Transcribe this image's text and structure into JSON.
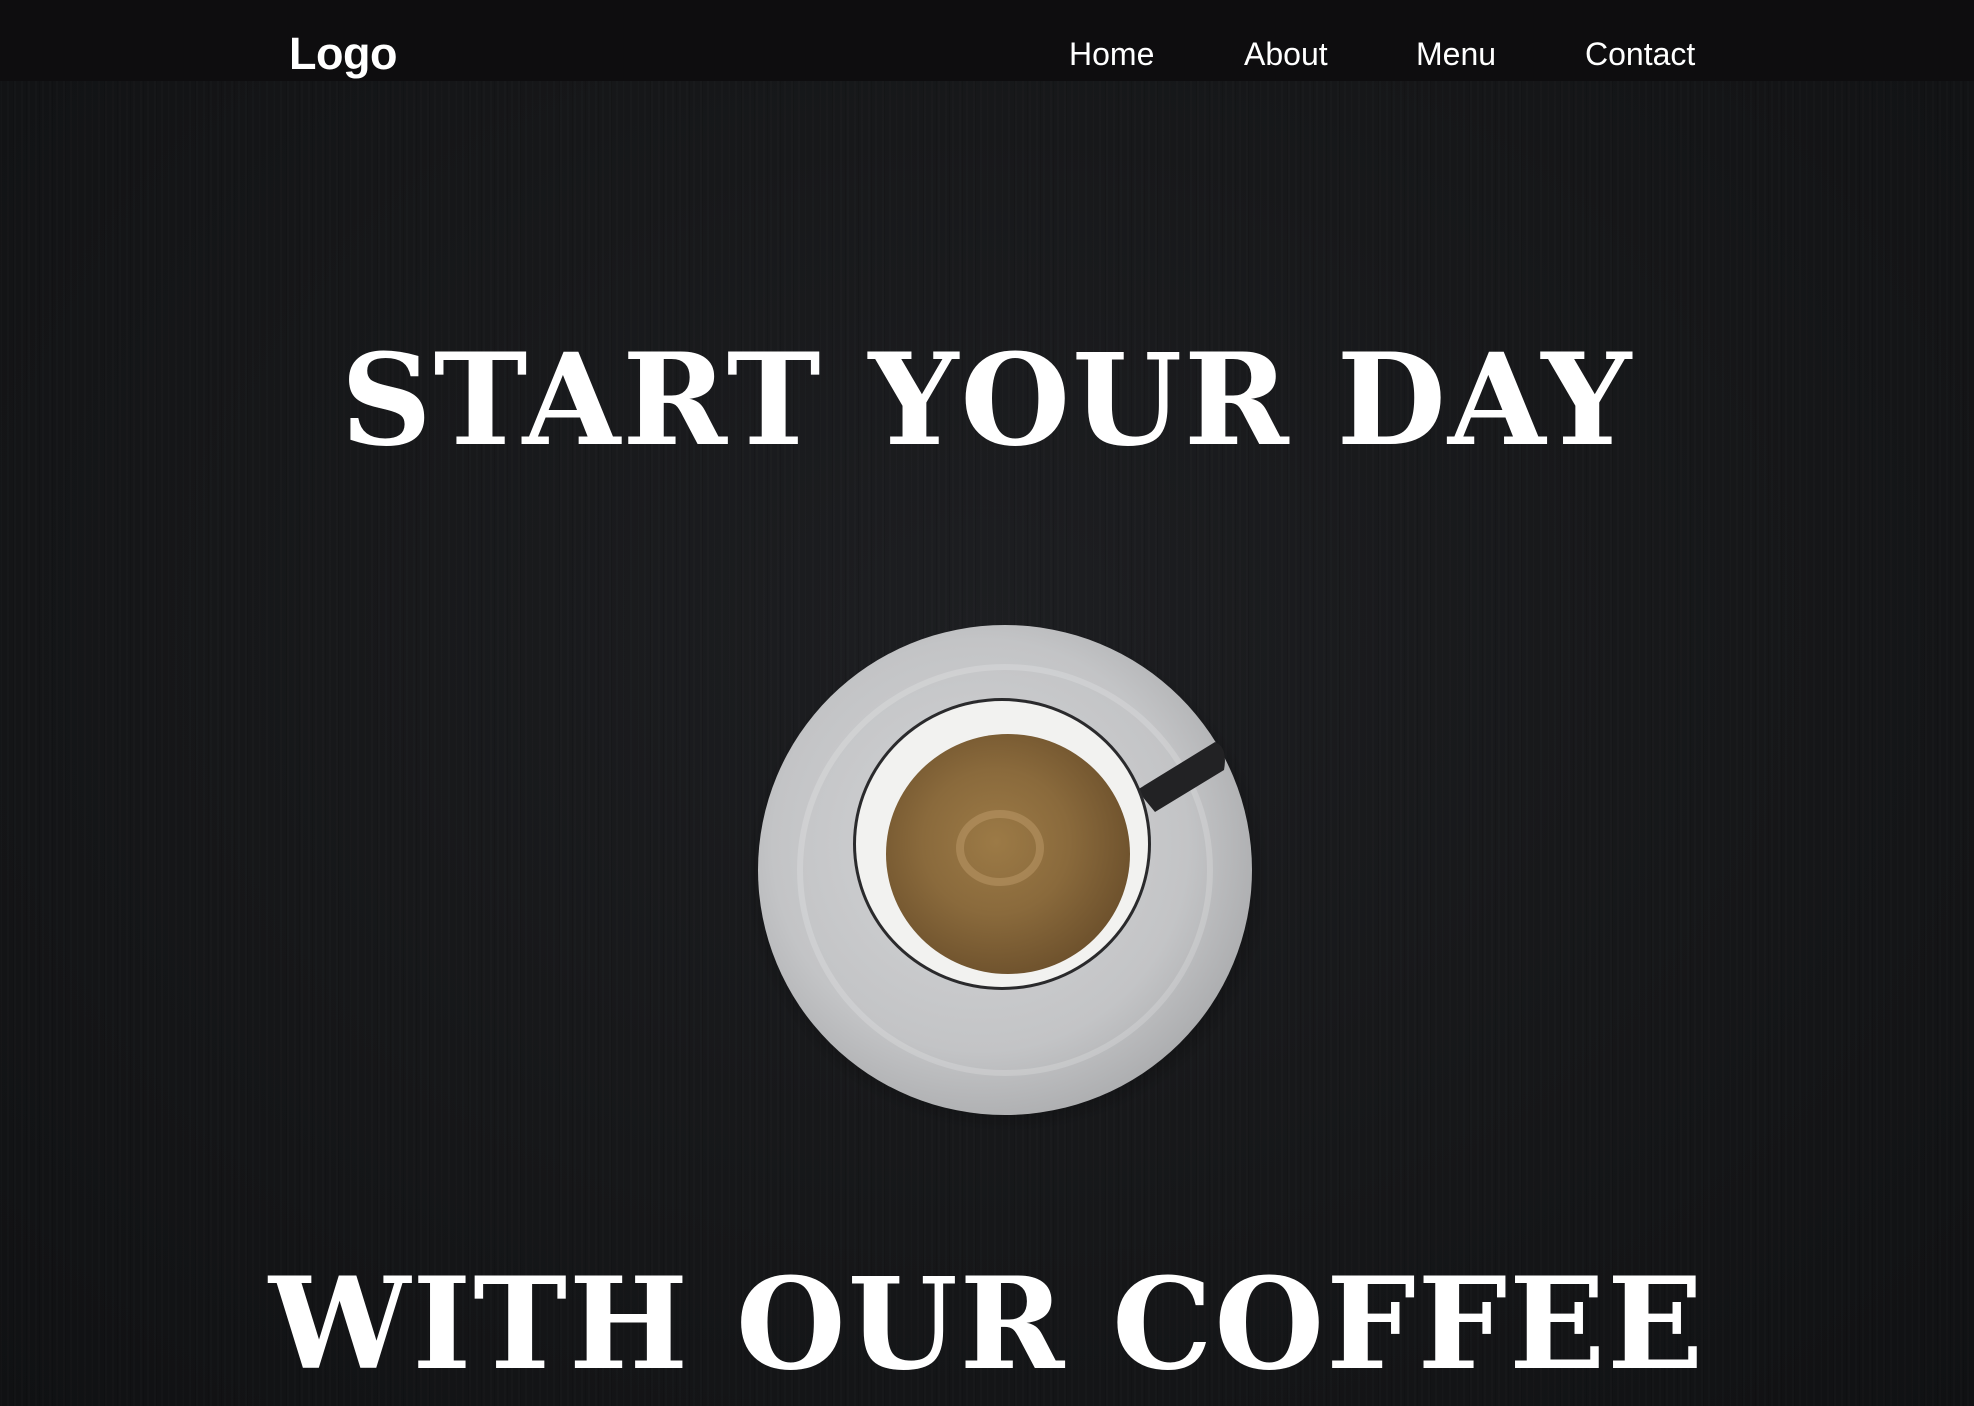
{
  "nav": {
    "logo": "Logo",
    "links": [
      "Home",
      "About",
      "Menu",
      "Contact"
    ]
  },
  "hero": {
    "line1": "START YOUR DAY",
    "line2": "WITH OUR COFFEE",
    "image": "espresso-cup-on-saucer"
  },
  "colors": {
    "background": "#141416",
    "navbar": "#0e0d0f",
    "text": "#ffffff",
    "saucer": "#c9cacc",
    "coffee": "#8a6a3c"
  }
}
